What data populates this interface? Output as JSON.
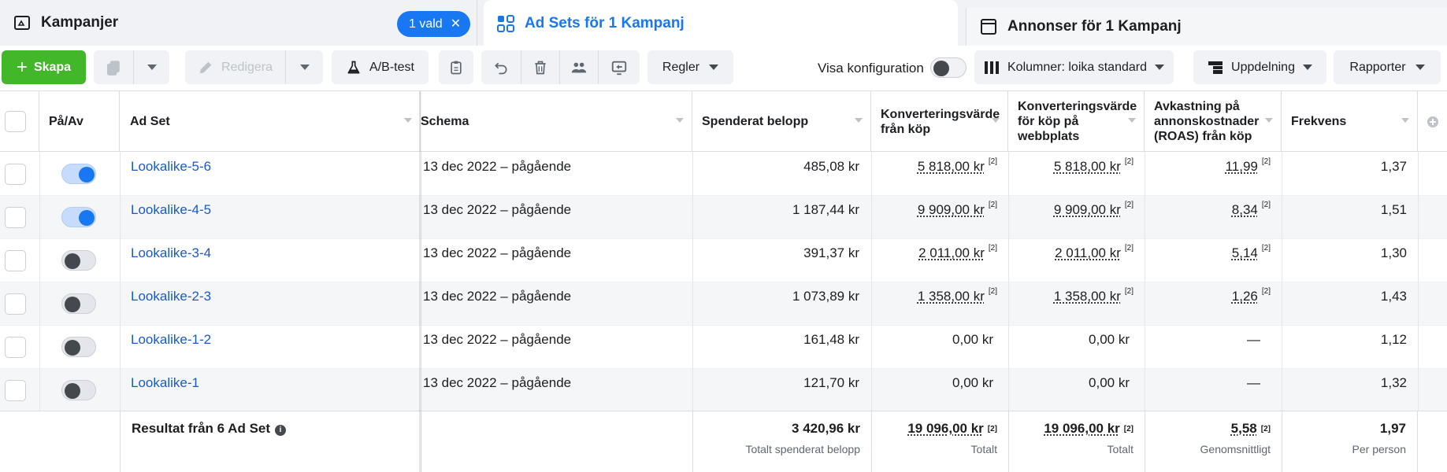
{
  "tabs": {
    "campaigns": {
      "label": "Kampanjer",
      "chip": "1 vald"
    },
    "adsets": {
      "label": "Ad Sets för 1 Kampanj"
    },
    "ads": {
      "label": "Annonser för 1 Kampanj"
    }
  },
  "toolbar": {
    "create_label": "Skapa",
    "edit_label": "Redigera",
    "ab_test_label": "A/B-test",
    "rules_label": "Regler",
    "show_config_label": "Visa konfiguration",
    "columns_label": "Kolumner: loika standard",
    "breakdown_label": "Uppdelning",
    "reports_label": "Rapporter"
  },
  "table": {
    "headers": {
      "onoff": "På/Av",
      "adset": "Ad Set",
      "schedule": "Schema",
      "spent": "Spenderat belopp",
      "conv_value": "Konverteringsvärde från köp",
      "conv_web": "Konverteringsvärde för köp på webbplats",
      "roas": "Avkastning på annonskostnader (ROAS) från köp",
      "frequency": "Frekvens"
    },
    "rows": [
      {
        "on": true,
        "name": "Lookalike-5-6",
        "schedule": "13 dec 2022 – pågående",
        "spent": "485,08 kr",
        "conv_value": "5 818,00 kr",
        "conv_value_sup": "[2]",
        "conv_web": "5 818,00 kr",
        "conv_web_sup": "[2]",
        "roas": "11,99",
        "roas_sup": "[2]",
        "frequency": "1,37"
      },
      {
        "on": true,
        "name": "Lookalike-4-5",
        "schedule": "13 dec 2022 – pågående",
        "spent": "1 187,44 kr",
        "conv_value": "9 909,00 kr",
        "conv_value_sup": "[2]",
        "conv_web": "9 909,00 kr",
        "conv_web_sup": "[2]",
        "roas": "8,34",
        "roas_sup": "[2]",
        "frequency": "1,51"
      },
      {
        "on": false,
        "name": "Lookalike-3-4",
        "schedule": "13 dec 2022 – pågående",
        "spent": "391,37 kr",
        "conv_value": "2 011,00 kr",
        "conv_value_sup": "[2]",
        "conv_web": "2 011,00 kr",
        "conv_web_sup": "[2]",
        "roas": "5,14",
        "roas_sup": "[2]",
        "frequency": "1,30"
      },
      {
        "on": false,
        "name": "Lookalike-2-3",
        "schedule": "13 dec 2022 – pågående",
        "spent": "1 073,89 kr",
        "conv_value": "1 358,00 kr",
        "conv_value_sup": "[2]",
        "conv_web": "1 358,00 kr",
        "conv_web_sup": "[2]",
        "roas": "1,26",
        "roas_sup": "[2]",
        "frequency": "1,43"
      },
      {
        "on": false,
        "name": "Lookalike-1-2",
        "schedule": "13 dec 2022 – pågående",
        "spent": "161,48 kr",
        "conv_value": "0,00 kr",
        "conv_value_sup": "",
        "conv_web": "0,00 kr",
        "conv_web_sup": "",
        "roas": "—",
        "roas_sup": "",
        "frequency": "1,12"
      },
      {
        "on": false,
        "name": "Lookalike-1",
        "schedule": "13 dec 2022 – pågående",
        "spent": "121,70 kr",
        "conv_value": "0,00 kr",
        "conv_value_sup": "",
        "conv_web": "0,00 kr",
        "conv_web_sup": "",
        "roas": "—",
        "roas_sup": "",
        "frequency": "1,32"
      }
    ],
    "totals": {
      "label": "Resultat från 6 Ad Set",
      "spent": "3 420,96 kr",
      "spent_sub": "Totalt spenderat belopp",
      "conv_value": "19 096,00 kr",
      "conv_value_sup": "[2]",
      "conv_value_sub": "Totalt",
      "conv_web": "19 096,00 kr",
      "conv_web_sup": "[2]",
      "conv_web_sub": "Totalt",
      "roas": "5,58",
      "roas_sup": "[2]",
      "roas_sub": "Genomsnittligt",
      "frequency": "1,97",
      "frequency_sub": "Per person"
    }
  },
  "colors": {
    "accent": "#1877f2",
    "create": "#42b72a",
    "link": "#1a5bc2"
  }
}
